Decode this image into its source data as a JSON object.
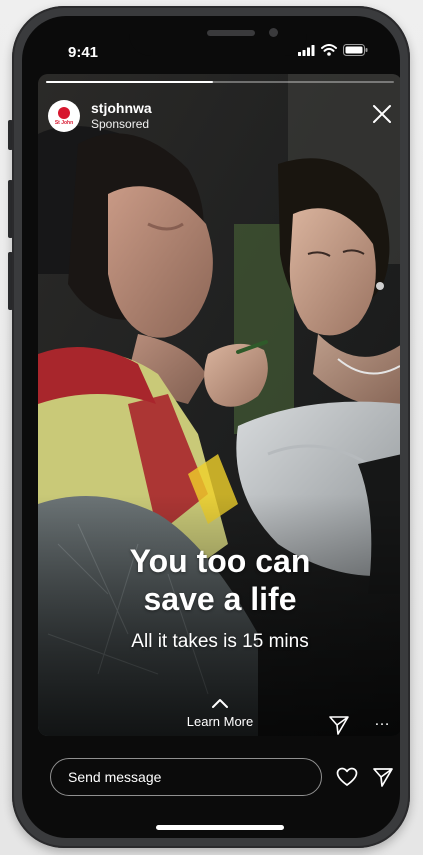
{
  "status_bar": {
    "time": "9:41"
  },
  "story": {
    "progress": 0.48,
    "account": {
      "username": "stjohnwa",
      "label": "Sponsored",
      "avatar_text": "St John"
    },
    "headline_line1": "You too can",
    "headline_line2": "save a life",
    "subheadline": "All it takes is 15 mins",
    "cta_label": "Learn More",
    "more_label": "…"
  },
  "reply_bar": {
    "placeholder": "Send message"
  },
  "colors": {
    "brand_red": "#d7172f",
    "text": "#ffffff",
    "background": "#0b0b0b"
  },
  "icons": [
    "close-icon",
    "chevron-up-icon",
    "paper-plane-icon",
    "more-icon",
    "heart-icon",
    "signal-icon",
    "wifi-icon",
    "battery-icon"
  ]
}
